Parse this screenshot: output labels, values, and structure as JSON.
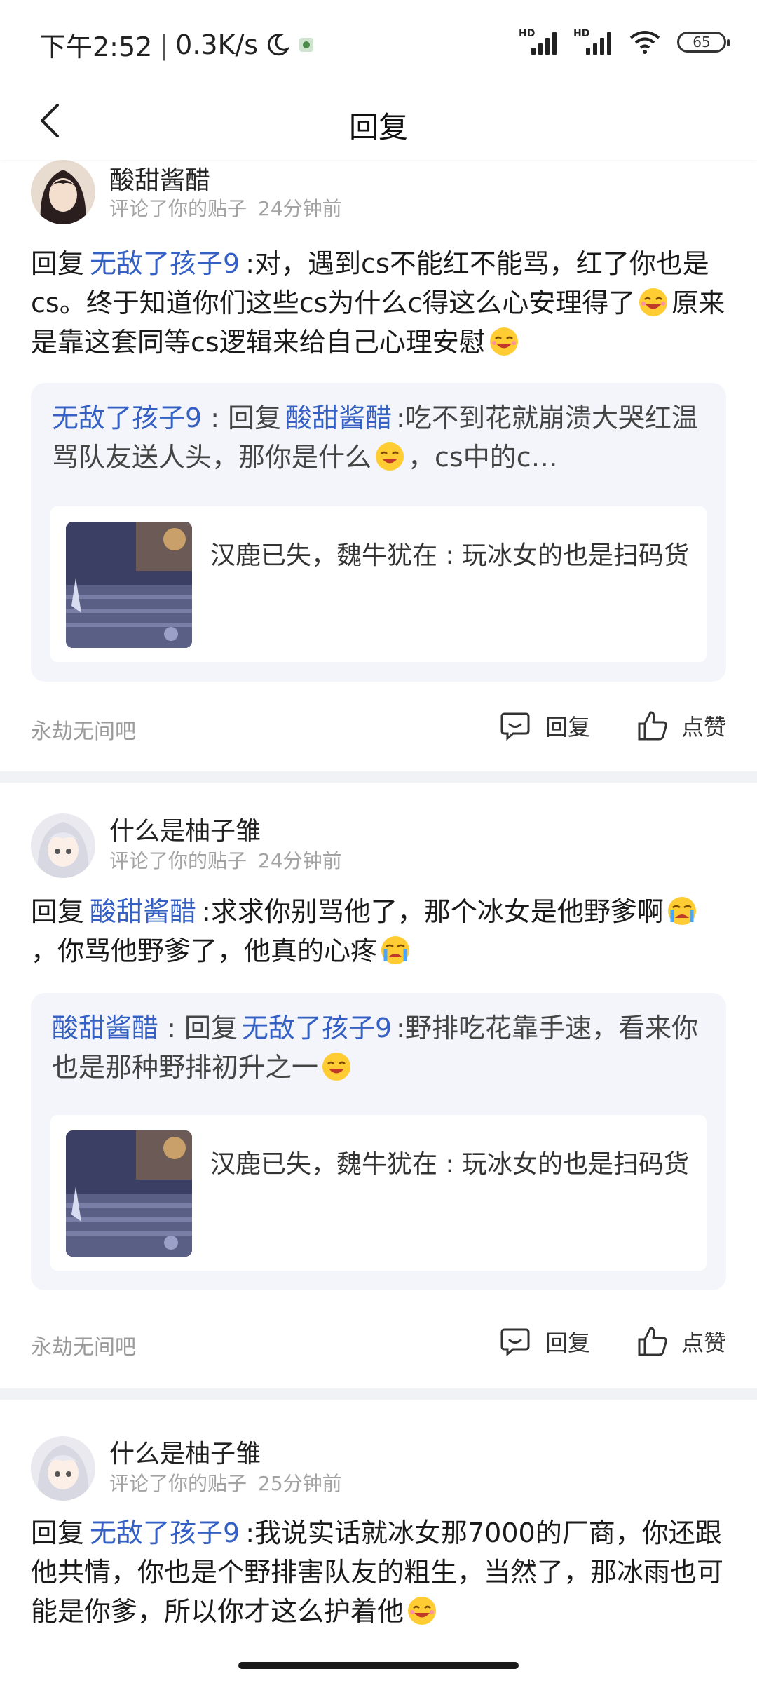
{
  "status_bar": {
    "time": "下午2:52",
    "speed": "0.3K/s",
    "signal_label": "HD",
    "battery": "65",
    "icons": [
      "moon-icon",
      "app-notification-icon",
      "signal-icon",
      "signal-icon",
      "wifi-icon",
      "battery-icon"
    ]
  },
  "header": {
    "title": "回复",
    "back_icon": "chevron-left-icon"
  },
  "comments": [
    {
      "user": "酸甜酱醋",
      "action": "评论了你的贴子",
      "time": "24分钟前",
      "reply_prefix": "回复",
      "mention": "无敌了孩子9",
      "text_a": ":对，遇到cs不能红不能骂，红了你也是cs。终于知道你们这些cs为什么c得这么心安理得了",
      "text_b": "原来是靠这套同等cs逻辑来给自己心理安慰",
      "quote": {
        "author": "无敌了孩子9",
        "sep": " : 回复",
        "mention": "酸甜酱醋",
        "text_a": ":吃不到花就崩溃大哭红温骂队友送人头，那你是什么",
        "text_b": "，cs中的c…"
      },
      "post": {
        "text": "汉鹿已失，魏牛犹在 : 玩冰女的也是扫码货"
      },
      "forum": "永劫无间吧",
      "reply_label": "回复",
      "like_label": "点赞"
    },
    {
      "user": "什么是柚子雏",
      "action": "评论了你的贴子",
      "time": "24分钟前",
      "reply_prefix": "回复",
      "mention": "酸甜酱醋",
      "text_a": ":求求你别骂他了，那个冰女是他野爹啊",
      "text_b": "，你骂他野爹了，他真的心疼",
      "quote": {
        "author": "酸甜酱醋",
        "sep": " : 回复",
        "mention": "无敌了孩子9",
        "text_a": ":野排吃花靠手速，看来你也是那种野排初升之一",
        "text_b": ""
      },
      "post": {
        "text": "汉鹿已失，魏牛犹在 : 玩冰女的也是扫码货"
      },
      "forum": "永劫无间吧",
      "reply_label": "回复",
      "like_label": "点赞"
    },
    {
      "user": "什么是柚子雏",
      "action": "评论了你的贴子",
      "time": "25分钟前",
      "reply_prefix": "回复",
      "mention": "无敌了孩子9",
      "text_a": ":我说实话就冰女那7000的厂商，你还跟他共情，你也是个野排害队友的粗生，当然了，那冰雨也可能是你爹，所以你才这么护着他",
      "text_b": ""
    }
  ]
}
